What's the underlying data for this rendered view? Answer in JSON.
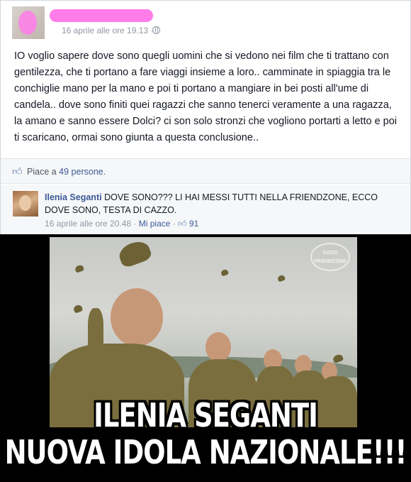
{
  "post": {
    "timestamp": "16 aprile alle ore 19.13 ·",
    "body": "IO voglio sapere dove sono quegli uomini che si vedono nei film che ti trattano con gentilezza, che ti portano a fare viaggi insieme a loro.. camminate in spiaggia tra le conchiglie mano per la mano e poi ti portano a mangiare in bei posti all'ume di candela.. dove sono finiti quei ragazzi che sanno tenerci veramente a una ragazza, la amano e sanno essere Dolci? ci son solo stronzi che vogliono portarti a letto e poi ti scaricano, ormai sono giunta a questa conclusione..",
    "likes_prefix": "Piace a ",
    "likes_link": "49 persone",
    "likes_suffix": "."
  },
  "comment": {
    "author": "Ilenia Seganti",
    "text": " DOVE SONO??? LI HAI MESSI TUTTI NELLA FRIENDZONE, ECCO DOVE SONO, TESTA DI CAZZO.",
    "timestamp": "16 aprile alle ore 20.48 · ",
    "like_action": "Mi piace",
    "separator": " · ",
    "like_count": "91"
  },
  "meme": {
    "watermark": "GOOD FRIENDZONE ",
    "caption_line1": "ILENIA SEGANTI",
    "caption_line2": "NUOVA IDOLA NAZIONALE!!!"
  },
  "icons": {
    "globe": "globe-icon",
    "thumb": "thumbs-up-icon"
  },
  "colors": {
    "link": "#3b5998",
    "meta": "#9197a3",
    "redaction": "#ff7ce9"
  }
}
